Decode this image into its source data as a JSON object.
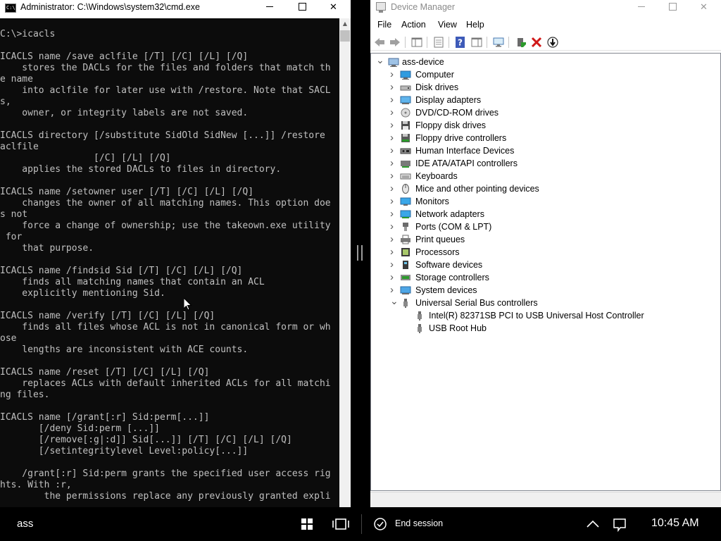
{
  "cmd": {
    "title": "Administrator: C:\\Windows\\system32\\cmd.exe",
    "icon": "cmd-app-icon",
    "icon_text": "C:\\",
    "lines": [
      "C:\\>icacls",
      "",
      "ICACLS name /save aclfile [/T] [/C] [/L] [/Q]",
      "    stores the DACLs for the files and folders that match th",
      "e name",
      "    into aclfile for later use with /restore. Note that SACL",
      "s,",
      "    owner, or integrity labels are not saved.",
      "",
      "ICACLS directory [/substitute SidOld SidNew [...]] /restore ",
      "aclfile",
      "                 [/C] [/L] [/Q]",
      "    applies the stored DACLs to files in directory.",
      "",
      "ICACLS name /setowner user [/T] [/C] [/L] [/Q]",
      "    changes the owner of all matching names. This option doe",
      "s not",
      "    force a change of ownership; use the takeown.exe utility",
      " for",
      "    that purpose.",
      "",
      "ICACLS name /findsid Sid [/T] [/C] [/L] [/Q]",
      "    finds all matching names that contain an ACL",
      "    explicitly mentioning Sid.",
      "",
      "ICACLS name /verify [/T] [/C] [/L] [/Q]",
      "    finds all files whose ACL is not in canonical form or wh",
      "ose",
      "    lengths are inconsistent with ACE counts.",
      "",
      "ICACLS name /reset [/T] [/C] [/L] [/Q]",
      "    replaces ACLs with default inherited ACLs for all matchi",
      "ng files.",
      "",
      "ICACLS name [/grant[:r] Sid:perm[...]]",
      "       [/deny Sid:perm [...]]",
      "       [/remove[:g|:d]] Sid[...]] [/T] [/C] [/L] [/Q]",
      "       [/setintegritylevel Level:policy[...]]",
      "",
      "    /grant[:r] Sid:perm grants the specified user access rig",
      "hts. With :r,",
      "        the permissions replace any previously granted expli"
    ],
    "text_color": "#c0c0c0",
    "background": "#0c0c0c"
  },
  "devmgr": {
    "title": "Device Manager",
    "menu": [
      "File",
      "Action",
      "View",
      "Help"
    ],
    "toolbar_icons": [
      "back-icon",
      "forward-icon",
      "show-hide-tree-icon",
      "properties-icon",
      "help-icon",
      "action-pane-icon",
      "scan-hardware-icon",
      "update-driver-icon",
      "uninstall-device-icon",
      "disable-device-icon"
    ],
    "root": "ass-device",
    "categories": [
      {
        "label": "Computer",
        "icon": "computer-icon",
        "expanded": false
      },
      {
        "label": "Disk drives",
        "icon": "disk-drive-icon",
        "expanded": false
      },
      {
        "label": "Display adapters",
        "icon": "display-adapter-icon",
        "expanded": false
      },
      {
        "label": "DVD/CD-ROM drives",
        "icon": "dvd-icon",
        "expanded": false
      },
      {
        "label": "Floppy disk drives",
        "icon": "floppy-icon",
        "expanded": false
      },
      {
        "label": "Floppy drive controllers",
        "icon": "floppy-controller-icon",
        "expanded": false
      },
      {
        "label": "Human Interface Devices",
        "icon": "hid-icon",
        "expanded": false
      },
      {
        "label": "IDE ATA/ATAPI controllers",
        "icon": "ide-icon",
        "expanded": false
      },
      {
        "label": "Keyboards",
        "icon": "keyboard-icon",
        "expanded": false
      },
      {
        "label": "Mice and other pointing devices",
        "icon": "mouse-icon",
        "expanded": false
      },
      {
        "label": "Monitors",
        "icon": "monitor-icon",
        "expanded": false
      },
      {
        "label": "Network adapters",
        "icon": "network-icon",
        "expanded": false
      },
      {
        "label": "Ports (COM & LPT)",
        "icon": "port-icon",
        "expanded": false
      },
      {
        "label": "Print queues",
        "icon": "printer-icon",
        "expanded": false
      },
      {
        "label": "Processors",
        "icon": "processor-icon",
        "expanded": false
      },
      {
        "label": "Software devices",
        "icon": "software-device-icon",
        "expanded": false
      },
      {
        "label": "Storage controllers",
        "icon": "storage-icon",
        "expanded": false
      },
      {
        "label": "System devices",
        "icon": "system-device-icon",
        "expanded": false
      },
      {
        "label": "Universal Serial Bus controllers",
        "icon": "usb-icon",
        "expanded": true,
        "children": [
          {
            "label": "Intel(R) 82371SB PCI to USB Universal Host Controller",
            "icon": "usb-icon"
          },
          {
            "label": "USB Root Hub",
            "icon": "usb-icon"
          }
        ]
      }
    ]
  },
  "taskbar": {
    "user": "ass",
    "end_session": "End session",
    "clock": "10:45 AM",
    "icons": [
      "windows-start-icon",
      "task-view-icon",
      "end-session-icon",
      "chevron-up-icon",
      "notification-icon"
    ]
  }
}
